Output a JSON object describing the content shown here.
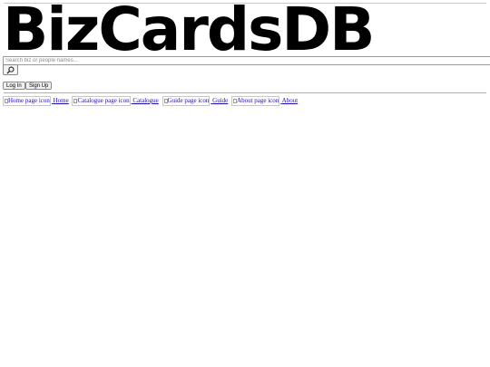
{
  "site": {
    "logo_text": "BizCardsDB"
  },
  "search": {
    "placeholder": "Search biz or people names...",
    "button_icon": "search-icon"
  },
  "auth": {
    "login_label": "Log In",
    "signup_label": "Sign Up"
  },
  "nav": {
    "items": [
      {
        "icon_alt": "Home page icon",
        "label": "Home"
      },
      {
        "icon_alt": "Catalogue page icon",
        "label": "Catalogue"
      },
      {
        "icon_alt": "Guide page icon",
        "label": "Guide"
      },
      {
        "icon_alt": "About page icon",
        "label": "About"
      }
    ]
  }
}
